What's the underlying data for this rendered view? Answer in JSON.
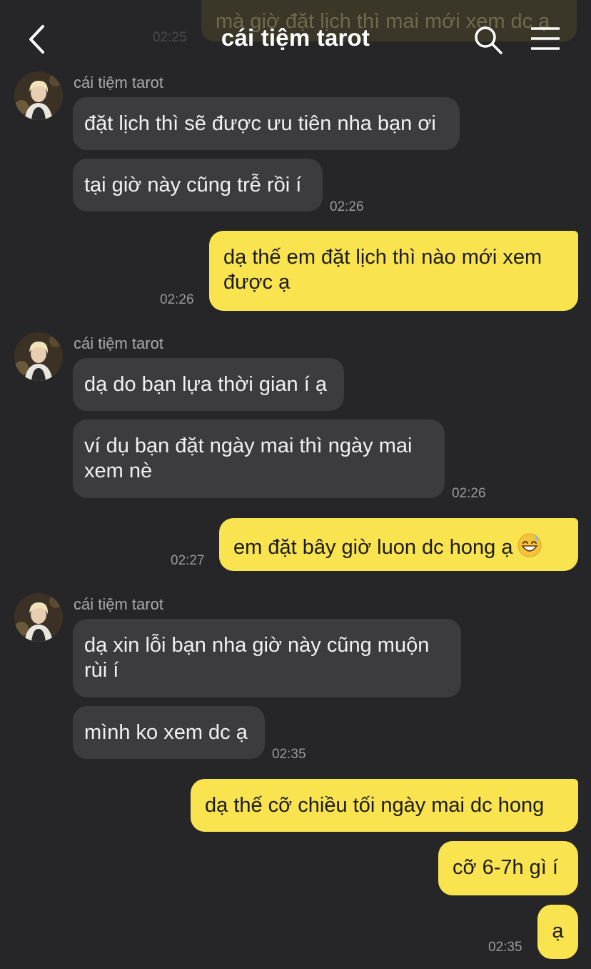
{
  "header": {
    "title": "cái tiệm tarot"
  },
  "previous_message": {
    "text": "mà giờ đặt lịch thì mai mới xem dc ạ",
    "time": "02:25"
  },
  "groups": [
    {
      "sender": "cái tiệm tarot",
      "messages": [
        "đặt lịch thì sẽ được ưu tiên nha bạn ơi",
        "tại giờ này cũng trễ rồi í"
      ],
      "time": "02:26"
    },
    {
      "outgoing": true,
      "messages": [
        "dạ thế em đặt lịch thì nào mới xem được ạ"
      ],
      "time": "02:26"
    },
    {
      "sender": "cái tiệm tarot",
      "messages": [
        "dạ do bạn lựa thời gian í ạ",
        "ví dụ bạn đặt ngày mai thì ngày mai xem nè"
      ],
      "time": "02:26"
    },
    {
      "outgoing": true,
      "messages": [
        "em đặt bây giờ luon dc hong ạ"
      ],
      "emoji": "grinning-face-with-sweat",
      "time": "02:27"
    },
    {
      "sender": "cái tiệm tarot",
      "messages": [
        "dạ xin lỗi bạn nha giờ này cũng muộn rùi í",
        "mình ko xem dc ạ"
      ],
      "time": "02:35"
    },
    {
      "outgoing": true,
      "messages": [
        "dạ thế cỡ chiều tối ngày mai dc hong",
        "cỡ 6-7h gì í",
        "ạ"
      ],
      "time": "02:35"
    }
  ],
  "colors": {
    "background": "#262628",
    "incoming_bubble": "#3c3c3f",
    "outgoing_bubble": "#f9e34e"
  }
}
